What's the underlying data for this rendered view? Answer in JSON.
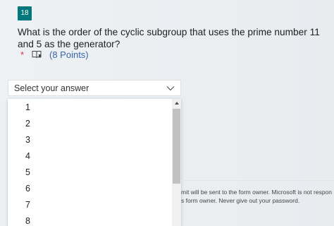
{
  "question": {
    "number": "18",
    "title": "What is the order of the cyclic subgroup that uses the prime number 11 and 5 as the generator?",
    "required_mark": "*",
    "points": "(8 Points)",
    "reader_icon": "immersive-reader-icon"
  },
  "answer_select": {
    "placeholder": "Select your answer",
    "icon": "chevron-down-icon",
    "options": [
      "1",
      "2",
      "3",
      "4",
      "5",
      "6",
      "7",
      "8"
    ]
  },
  "footer_notice": {
    "line1": "mit will be sent to the form owner. Microsoft is not respon",
    "line2": "s form owner. Never give out your password."
  },
  "colors": {
    "badge": "#03787c",
    "required": "#d13438",
    "points": "#3a64a8"
  }
}
